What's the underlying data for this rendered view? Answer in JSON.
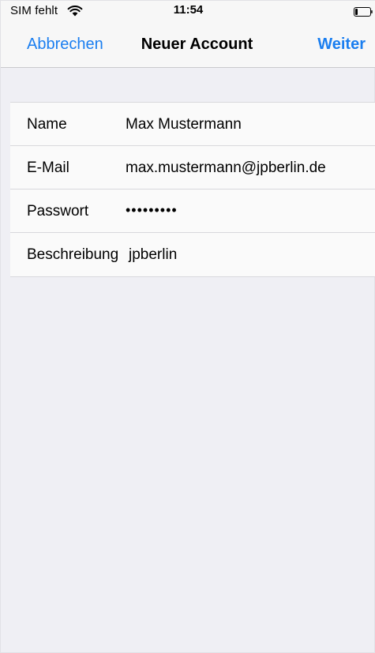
{
  "status_bar": {
    "carrier": "SIM fehlt",
    "time": "11:54",
    "wifi_icon": "wifi-icon",
    "battery_icon": "battery-icon"
  },
  "nav": {
    "cancel_label": "Abbrechen",
    "title": "Neuer Account",
    "next_label": "Weiter"
  },
  "form": {
    "rows": [
      {
        "label": "Name",
        "value": "Max Mustermann"
      },
      {
        "label": "E-Mail",
        "value": "max.mustermann@jpberlin.de"
      },
      {
        "label": "Passwort",
        "value": "•••••••••"
      },
      {
        "label": "Beschreibung",
        "value": "jpberlin"
      }
    ]
  },
  "colors": {
    "accent": "#1a7ef0",
    "background": "#efeff4",
    "bar_background": "#f7f7f7",
    "cell_background": "#fafafa"
  }
}
